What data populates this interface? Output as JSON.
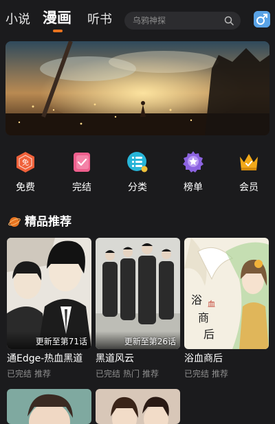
{
  "tabs": [
    {
      "label": "小说"
    },
    {
      "label": "漫画"
    },
    {
      "label": "听书"
    }
  ],
  "search": {
    "placeholder": "乌鸦神探"
  },
  "categories": [
    {
      "label": "免费",
      "icon": "free-icon",
      "icon_text": "免",
      "color": "#f0613a"
    },
    {
      "label": "完结",
      "icon": "completed-icon",
      "color": "#ef5f8d"
    },
    {
      "label": "分类",
      "icon": "category-icon",
      "color": "#27b5d8"
    },
    {
      "label": "榜单",
      "icon": "ranking-icon",
      "color": "#8c63e0"
    },
    {
      "label": "会员",
      "icon": "vip-crown-icon",
      "color": "#f2a91a"
    }
  ],
  "section": {
    "title": "精品推荐",
    "accent": "#e8731f"
  },
  "comics": [
    {
      "title": "通Edge-热血黑道",
      "badge": "更新至第71话",
      "tags": [
        "已完结",
        "推荐"
      ]
    },
    {
      "title": "黑道风云",
      "badge": "更新至第26话",
      "tags": [
        "已完结",
        "热门",
        "推荐"
      ]
    },
    {
      "title": "浴血商后",
      "badge": "",
      "cover_text": "浴血商后",
      "tags": [
        "已完结",
        "推荐"
      ]
    }
  ]
}
